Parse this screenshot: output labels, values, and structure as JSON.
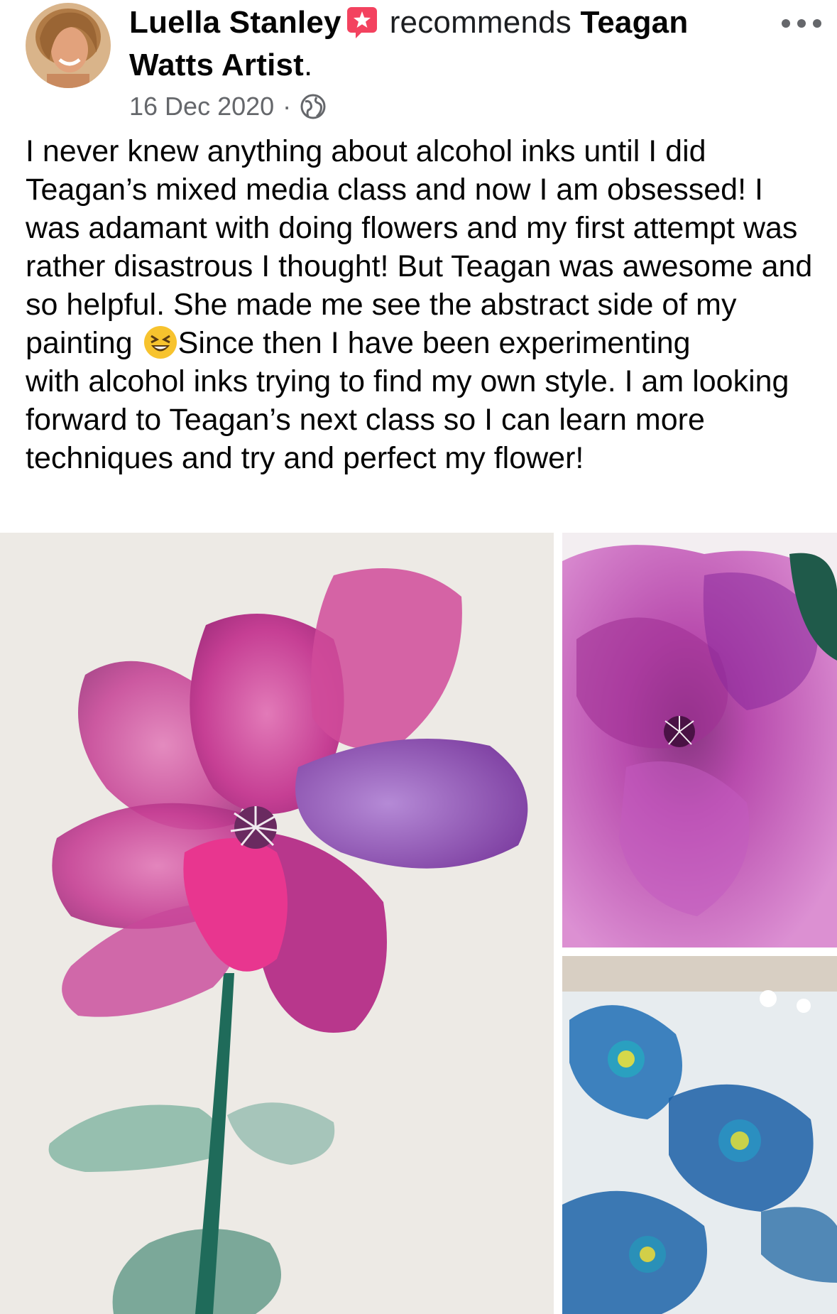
{
  "post": {
    "author": "Luella Stanley",
    "action": "recommends",
    "page_name_part1": "Teagan",
    "page_name_part2": "Watts Artist",
    "trailing_punct": ".",
    "date": "16 Dec 2020",
    "separator": "·",
    "audience_icon": "globe-icon",
    "recommend_icon": "recommendation-star-icon",
    "more_icon": "more-options-icon",
    "body": [
      "I never knew anything about alcohol inks until I did Teagan’s mixed media class and now I am obsessed! I was adamant with doing flowers and my first attempt was rather disastrous I thought! But Teagan was awesome and so helpful. She made me see the abstract side of my painting",
      "Since then I have been experimenting",
      "with alcohol inks trying to find my own style. I am looking forward to Teagan’s next class so I can learn more techniques and try and perfect my flower!"
    ],
    "emoji": "grinning-squinting-face-emoji"
  },
  "photos": [
    {
      "subject": "pink-purple-alcohol-ink-flower"
    },
    {
      "subject": "magenta-alcohol-ink-flower"
    },
    {
      "subject": "blue-alcohol-ink-flowers"
    }
  ],
  "colors": {
    "secondary_text": "#65676b",
    "recommend_badge": "#f3425f",
    "pink_ink": "#c03c95",
    "purple_ink": "#8a2a9c",
    "green_stem": "#1f6b5a",
    "blue_ink": "#1e6fb5"
  }
}
